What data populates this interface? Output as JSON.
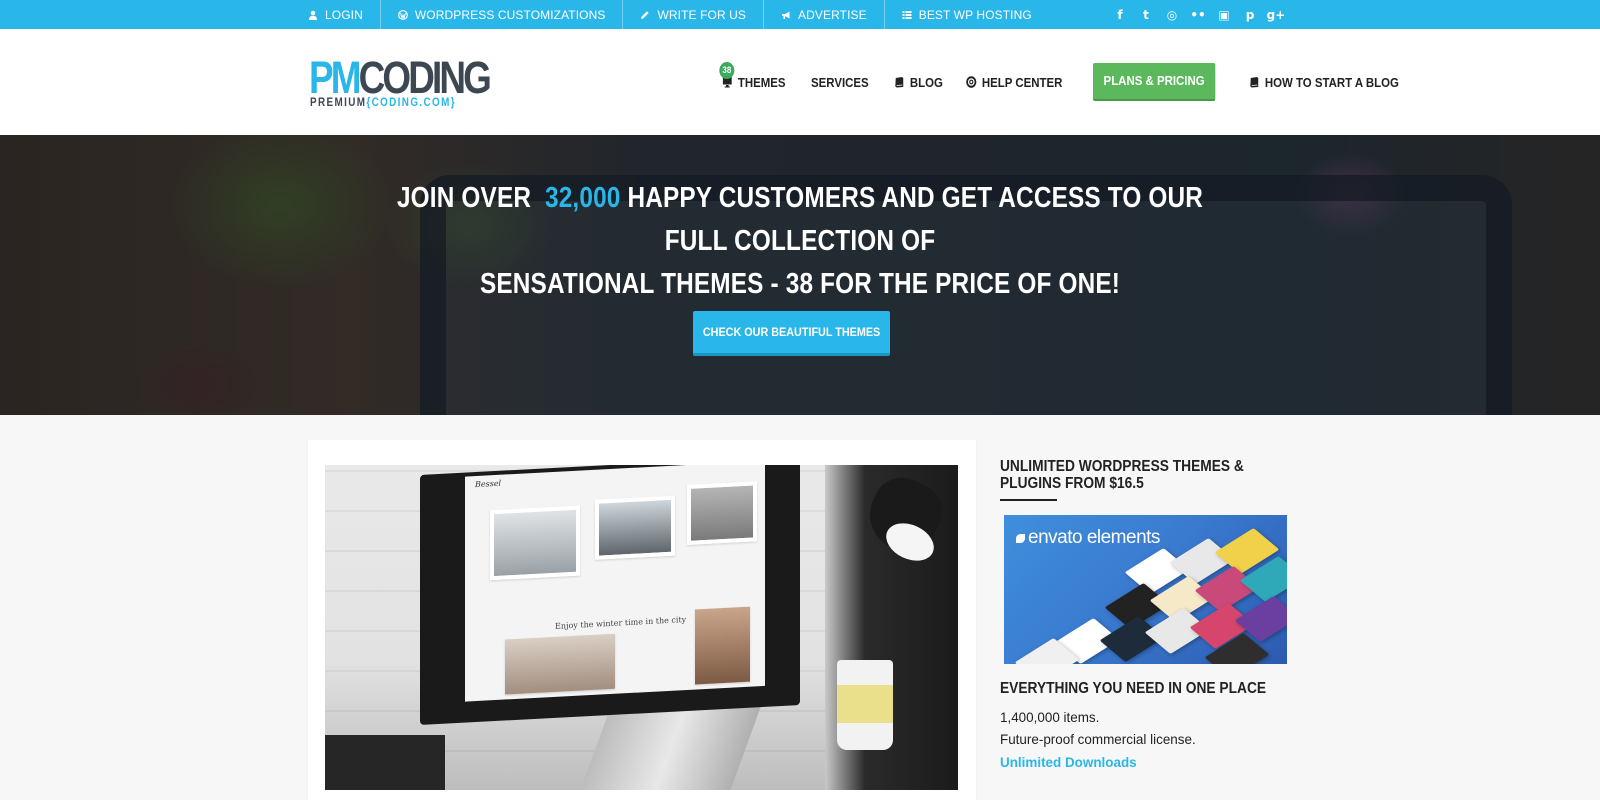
{
  "topbar": {
    "items": [
      {
        "label": "LOGIN",
        "icon": "user-icon"
      },
      {
        "label": "WORDPRESS CUSTOMIZATIONS",
        "icon": "wordpress-icon"
      },
      {
        "label": "WRITE FOR US",
        "icon": "pencil-icon"
      },
      {
        "label": "ADVERTISE",
        "icon": "megaphone-icon"
      },
      {
        "label": "BEST WP HOSTING",
        "icon": "list-icon"
      }
    ],
    "social": [
      {
        "icon": "facebook-icon",
        "glyph": "f"
      },
      {
        "icon": "twitter-icon",
        "glyph": "t"
      },
      {
        "icon": "dribbble-icon",
        "glyph": "◎"
      },
      {
        "icon": "flickr-icon",
        "glyph": "••"
      },
      {
        "icon": "instagram-icon",
        "glyph": "▣"
      },
      {
        "icon": "pinterest-icon",
        "glyph": "p"
      },
      {
        "icon": "googleplus-icon",
        "glyph": "g+"
      }
    ]
  },
  "logo": {
    "pm": "PM",
    "coding": "CODING",
    "sub_prefix": "PREMIUM",
    "sub_brand": "{CODING.COM}"
  },
  "nav": {
    "themes_badge": "38",
    "themes": "THEMES",
    "services": "SERVICES",
    "blog": "BLOG",
    "help_center": "HELP CENTER",
    "plans": "PLANS & PRICING",
    "how_to": "HOW TO START A BLOG"
  },
  "hero": {
    "line1_prefix": "JOIN OVER",
    "highlight": "32,000",
    "line1_suffix": "HAPPY CUSTOMERS AND GET ACCESS TO OUR FULL COLLECTION OF",
    "line2": "SENSATIONAL THEMES - 38 FOR THE PRICE OF ONE!",
    "button": "CHECK OUR BEAUTIFUL THEMES"
  },
  "card": {
    "screen_logo": "Bessel",
    "screen_caption": "Enjoy the winter time in the city"
  },
  "sidebar": {
    "title": "UNLIMITED WORDPRESS THEMES & PLUGINS FROM $16.5",
    "ad_brand": "envato elements",
    "heading": "EVERYTHING YOU NEED IN ONE PLACE",
    "line1": "1,400,000 items.",
    "line2": "Future-proof commercial license.",
    "link": "Unlimited Downloads"
  },
  "colors": {
    "accent": "#29b6e8",
    "plans_green": "#5cb85c",
    "badge_green": "#3aaa5c",
    "text_dark": "#222222"
  }
}
